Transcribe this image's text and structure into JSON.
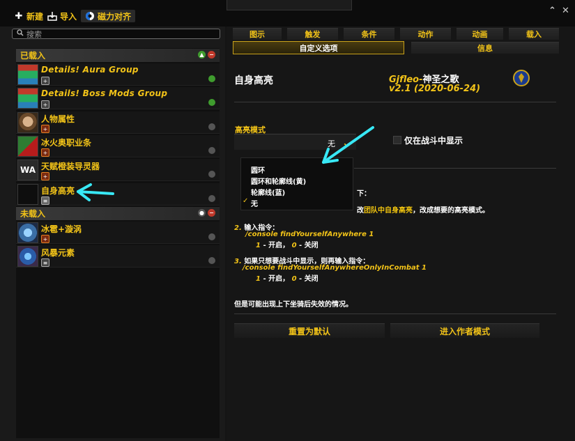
{
  "toolbar": {
    "new_label": "新建",
    "import_label": "导入",
    "snap_label": "磁力对齐"
  },
  "search": {
    "placeholder": "搜索"
  },
  "sections": {
    "loaded": "已载入",
    "unloaded": "未载入"
  },
  "loaded_items": [
    {
      "name": "Details! Aura Group",
      "italic": true
    },
    {
      "name": "Details! Boss Mods Group",
      "italic": true
    },
    {
      "name": "人物属性"
    },
    {
      "name": "冰火奥职业条"
    },
    {
      "name": "天赋橙装导灵器"
    },
    {
      "name": "自身高亮"
    }
  ],
  "unloaded_items": [
    {
      "name": "冰雹+漩涡"
    },
    {
      "name": "风暴元素"
    }
  ],
  "tabs_row1": [
    "图示",
    "触发",
    "条件",
    "动作",
    "动画",
    "载入"
  ],
  "tabs_row2": {
    "active": "自定义选项",
    "other": "信息"
  },
  "detail": {
    "title": "自身高亮",
    "author_line1_latin": "Gjfleo-",
    "author_line1_cn": "神圣之歌",
    "author_line2": "v2.1 (2020-06-24)",
    "mode_label": "高亮模式",
    "mode_value": "无",
    "combat_only_label": "仅在战斗中显示",
    "menu_options": [
      "圆环",
      "圆环和轮廓线(黄)",
      "轮廓线(蓝)",
      "无"
    ],
    "text_fragment1": "下：",
    "text_fragment2_pre": "改",
    "text_fragment2_gold": "团队中自身高亮",
    "text_fragment2_post": "，改成想要的高亮模式。",
    "step2_num": "2.",
    "step2_text": "输入指令：",
    "step2_cmd": "/console findYourselfAnywhere 1",
    "step2_note_1": "1",
    "step2_note_on": "- 开启，",
    "step2_note_0": "0",
    "step2_note_off": "- 关闭",
    "step3_num": "3.",
    "step3_text": "如果只想要战斗中显示，则再输入指令：",
    "step3_cmd": "/console findYourselfAnywhereOnlyInCombat 1",
    "step3_note_1": "1",
    "step3_note_on": "- 开启，",
    "step3_note_0": "0",
    "step3_note_off": "- 关闭",
    "footer_note": "但是可能出现上下坐骑后失效的情况。",
    "reset_button": "重置为默认",
    "author_mode_button": "进入作者模式"
  },
  "colors": {
    "accent": "#f2c318",
    "annotation_arrow": "#38e8f5"
  }
}
